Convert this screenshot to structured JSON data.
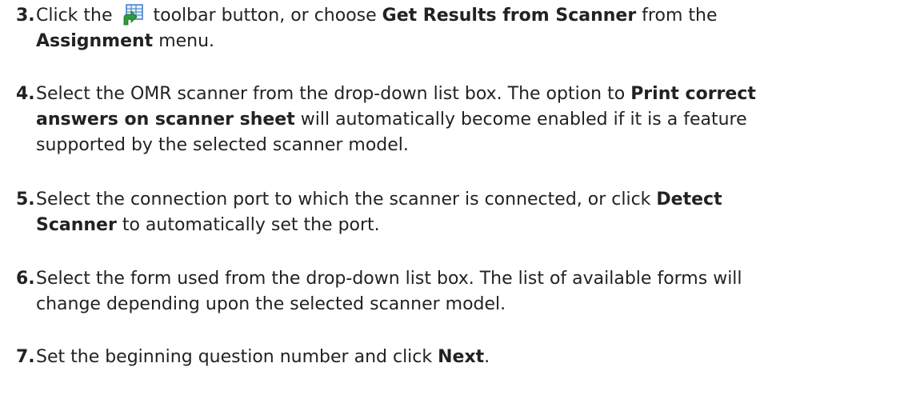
{
  "steps": [
    {
      "number": "3.",
      "segments": [
        {
          "text": "Click the ",
          "bold": false
        },
        {
          "icon": "get-results-scanner-icon"
        },
        {
          "text": " toolbar button, or choose ",
          "bold": false
        },
        {
          "text": "Get Results from Scanner",
          "bold": true
        },
        {
          "text": " from the ",
          "bold": false
        },
        {
          "break": true
        },
        {
          "text": "Assignment",
          "bold": true
        },
        {
          "text": " menu.",
          "bold": false
        }
      ]
    },
    {
      "number": "4.",
      "segments": [
        {
          "text": "Select the OMR scanner from the drop-down list box. The option to ",
          "bold": false
        },
        {
          "text": "Print correct",
          "bold": true
        },
        {
          "break": true
        },
        {
          "text": "answers on scanner sheet",
          "bold": true
        },
        {
          "text": " will automatically become enabled if it is a feature",
          "bold": false
        },
        {
          "break": true
        },
        {
          "text": "supported by the selected scanner model.",
          "bold": false
        }
      ]
    },
    {
      "number": "5.",
      "segments": [
        {
          "text": "Select the connection port to which the scanner is connected, or click ",
          "bold": false
        },
        {
          "text": "Detect",
          "bold": true
        },
        {
          "break": true
        },
        {
          "text": "Scanner",
          "bold": true
        },
        {
          "text": " to automatically set the port.",
          "bold": false
        }
      ]
    },
    {
      "number": "6.",
      "segments": [
        {
          "text": "Select the form used from the drop-down list box. The list of available forms will",
          "bold": false
        },
        {
          "break": true
        },
        {
          "text": "change depending upon the selected scanner model.",
          "bold": false
        }
      ]
    },
    {
      "number": "7.",
      "segments": [
        {
          "text": "Set the beginning question number and click ",
          "bold": false
        },
        {
          "text": "Next",
          "bold": true
        },
        {
          "text": ".",
          "bold": false
        }
      ]
    }
  ],
  "colors": {
    "text": "#222222",
    "icon_grid": "#3a7cc7",
    "icon_arrow": "#2e9b3c"
  }
}
